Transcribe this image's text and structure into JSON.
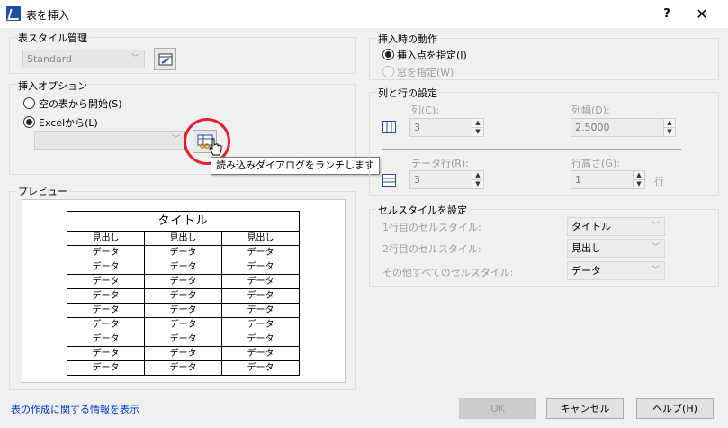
{
  "window": {
    "title": "表を挿入",
    "help": "?",
    "close": "✕"
  },
  "table_style": {
    "group_label": "表スタイル管理",
    "selected": "Standard"
  },
  "insert_options": {
    "group_label": "挿入オプション",
    "empty_table": "空の表から開始(S)",
    "from_excel": "Excelから(L)",
    "tooltip": "読み込みダイアログをランチします"
  },
  "preview": {
    "group_label": "プレビュー",
    "title": "タイトル",
    "header": [
      "見出し",
      "見出し",
      "見出し"
    ],
    "rows": [
      [
        "データ",
        "データ",
        "データ"
      ],
      [
        "データ",
        "データ",
        "データ"
      ],
      [
        "データ",
        "データ",
        "データ"
      ],
      [
        "データ",
        "データ",
        "データ"
      ],
      [
        "データ",
        "データ",
        "データ"
      ],
      [
        "データ",
        "データ",
        "データ"
      ],
      [
        "データ",
        "データ",
        "データ"
      ],
      [
        "データ",
        "データ",
        "データ"
      ],
      [
        "データ",
        "データ",
        "データ"
      ]
    ]
  },
  "insert_behavior": {
    "group_label": "挿入時の動作",
    "point": "挿入点を指定(I)",
    "window": "窓を指定(W)"
  },
  "rows_cols": {
    "group_label": "列と行の設定",
    "cols_label": "列(C):",
    "cols_value": "3",
    "col_width_label": "列幅(D):",
    "col_width_value": "2.5000",
    "data_rows_label": "データ行(R):",
    "data_rows_value": "3",
    "row_height_label": "行高さ(G):",
    "row_height_value": "1",
    "row_unit": "行"
  },
  "cell_styles": {
    "group_label": "セルスタイルを設定",
    "first_row_label": "1行目のセルスタイル:",
    "first_row_value": "タイトル",
    "second_row_label": "2行目のセルスタイル:",
    "second_row_value": "見出し",
    "other_rows_label": "その他すべてのセルスタイル:",
    "other_rows_value": "データ"
  },
  "footer": {
    "link": "表の作成に関する情報を表示",
    "ok": "OK",
    "cancel": "キャンセル",
    "help": "ヘルプ(H)"
  }
}
